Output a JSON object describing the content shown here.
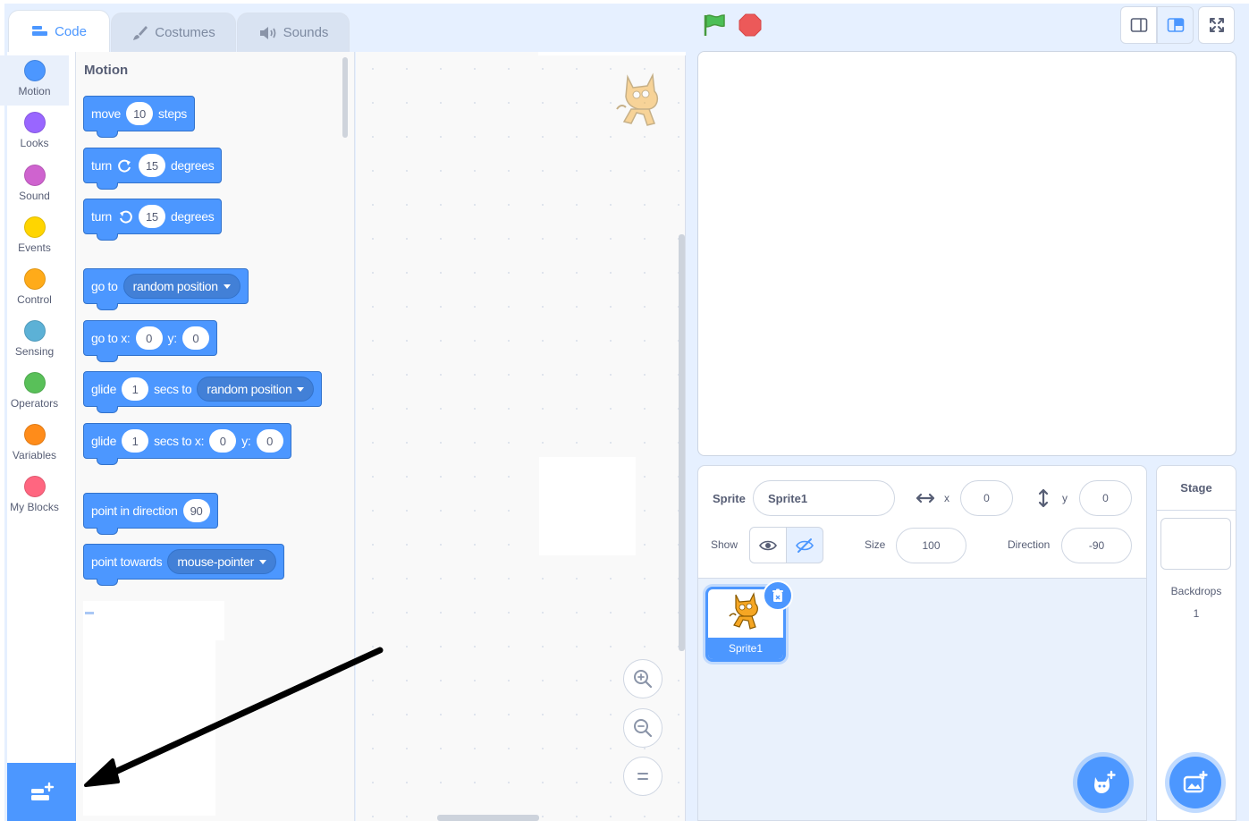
{
  "tabs": [
    {
      "label": "Code",
      "active": true
    },
    {
      "label": "Costumes",
      "active": false
    },
    {
      "label": "Sounds",
      "active": false
    }
  ],
  "categories": [
    {
      "label": "Motion",
      "color": "#4c97ff",
      "selected": true
    },
    {
      "label": "Looks",
      "color": "#9966ff"
    },
    {
      "label": "Sound",
      "color": "#cf63cf"
    },
    {
      "label": "Events",
      "color": "#ffd500"
    },
    {
      "label": "Control",
      "color": "#ffab19"
    },
    {
      "label": "Sensing",
      "color": "#5cb1d6"
    },
    {
      "label": "Operators",
      "color": "#59c059"
    },
    {
      "label": "Variables",
      "color": "#ff8c1a"
    },
    {
      "label": "My Blocks",
      "color": "#ff6680"
    }
  ],
  "palette": {
    "title": "Motion",
    "blocks": {
      "move": {
        "t1": "move",
        "v1": "10",
        "t2": "steps"
      },
      "turn_right": {
        "t1": "turn",
        "v1": "15",
        "t2": "degrees"
      },
      "turn_left": {
        "t1": "turn",
        "v1": "15",
        "t2": "degrees"
      },
      "go_to": {
        "t1": "go to",
        "dd": "random position"
      },
      "go_to_xy": {
        "t1": "go to x:",
        "v1": "0",
        "t2": "y:",
        "v2": "0"
      },
      "glide_to": {
        "t1": "glide",
        "v1": "1",
        "t2": "secs to",
        "dd": "random position"
      },
      "glide_xy": {
        "t1": "glide",
        "v1": "1",
        "t2": "secs to x:",
        "v2": "0",
        "t3": "y:",
        "v3": "0"
      },
      "point_dir": {
        "t1": "point in direction",
        "v1": "90"
      },
      "point_towards": {
        "t1": "point towards",
        "dd": "mouse-pointer"
      }
    }
  },
  "sprite_info": {
    "sprite_label": "Sprite",
    "sprite_name": "Sprite1",
    "x_label": "x",
    "x_value": "0",
    "y_label": "y",
    "y_value": "0",
    "show_label": "Show",
    "size_label": "Size",
    "size_value": "100",
    "direction_label": "Direction",
    "direction_value": "-90"
  },
  "sprite_list": [
    {
      "name": "Sprite1",
      "selected": true
    }
  ],
  "stage_panel": {
    "title": "Stage",
    "backdrops_label": "Backdrops",
    "backdrops_count": "1"
  },
  "colors": {
    "motion_blue": "#4c97ff",
    "flag_green": "#4cbf56",
    "stop_red": "#ec5959",
    "annotation_arrow": "#000000"
  }
}
